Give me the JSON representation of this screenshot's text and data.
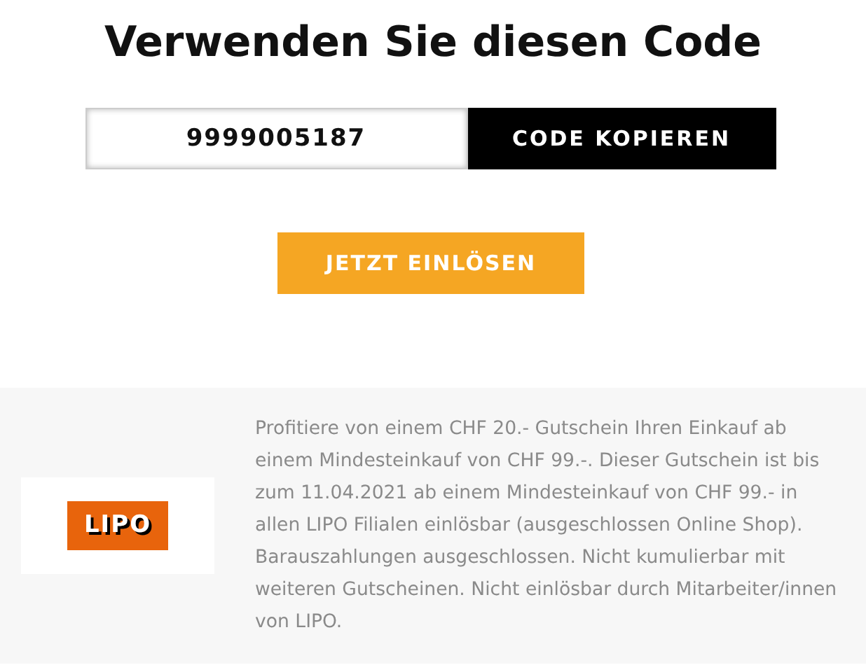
{
  "heading": "Verwenden Sie diesen Code",
  "code": {
    "value": "9999005187",
    "copy_button": "CODE KOPIEREN"
  },
  "redeem_button": "JETZT EINLÖSEN",
  "offer": {
    "logo_text": "LIPO",
    "description": "Profitiere von einem CHF 20.- Gutschein Ihren Einkauf ab einem Mindesteinkauf von CHF 99.-. Dieser Gutschein ist bis zum 11.04.2021 ab einem Mindesteinkauf von CHF 99.- in allen LIPO Filialen einlösbar (ausgeschlossen Online Shop). Barauszahlungen ausgeschlossen. Nicht kumulierbar mit weiteren Gutscheinen. Nicht einlösbar durch Mitarbeiter/innen von LIPO."
  }
}
